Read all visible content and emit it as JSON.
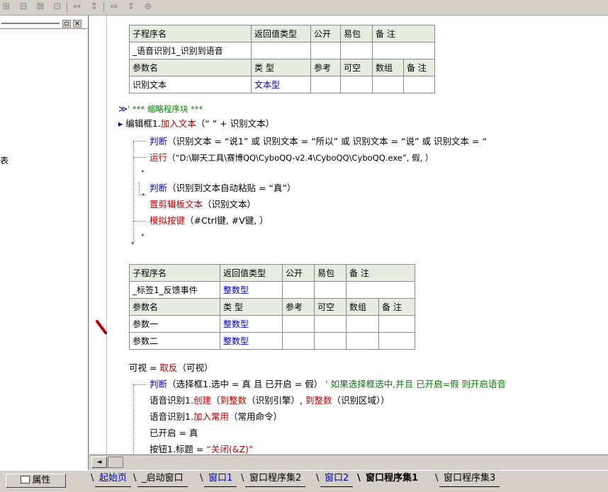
{
  "toolbar": {
    "icons": [
      "merge-cells-icon",
      "split-cells-icon",
      "insert-row-icon",
      "insert-col-icon",
      "width-icon",
      "height-icon",
      "fit-width-icon",
      "fit-height-icon",
      "fit-all-icon"
    ]
  },
  "left_panel": {
    "min_glyph": "▫",
    "close_glyph": "×",
    "fragment": "表"
  },
  "sub1": {
    "header": [
      "子程序名",
      "返回值类型",
      "公开",
      "易包",
      "备 注"
    ],
    "name": "_语音识别1_识别到语音",
    "param_header": [
      "参数名",
      "类 型",
      "参考",
      "可空",
      "数组",
      "备 注"
    ],
    "param_name": "识别文本",
    "param_type": "文本型"
  },
  "code1": {
    "fold_marker": "≫",
    "fold_comment": "' *** 缩略程序块 ***",
    "call_marker": "▸",
    "line1_obj": "编辑框1.",
    "line1_method": "加入文本",
    "line1_args": "（“ ” + 识别文本）",
    "line2_kw": "判断",
    "line2_rest": "（识别文本 = “说1” 或 识别文本 = “所以” 或 识别文本 = “说” 或 识别文本 = “",
    "line3_kw": "运行",
    "line3_args": "（“D:\\聊天工具\\赛博QQ\\CyboQQ-v2.4\\CyboQQ\\CyboQQ.exe”, 假, ）",
    "line4_kw": "判断",
    "line4_rest": "（识别到文本自动粘贴 = “真”）",
    "line5_kw": "置剪辑板文本",
    "line5_args": "（识别文本）",
    "line6_kw": "模拟按键",
    "line6_args": "（#Ctrl键, #V键, ）"
  },
  "sub2": {
    "header": [
      "子程序名",
      "返回值类型",
      "公开",
      "易包",
      "备 注"
    ],
    "name": "_标签1_反馈事件",
    "ret_type": "整数型",
    "param_header": [
      "参数名",
      "类 型",
      "参考",
      "可空",
      "数组",
      "备 注"
    ],
    "params": [
      {
        "name": "参数一",
        "type": "整数型"
      },
      {
        "name": "参数二",
        "type": "整数型"
      }
    ]
  },
  "code2": {
    "line1_a": "可视 = ",
    "line1_kw": "取反",
    "line1_args": "（可视）",
    "line2_kw": "判断",
    "line2_rest": "（选择框1.选中 = 真 且 已开启 = 假）",
    "line2_comment": "' 如果选择框选中,并且 已开启=假 则开启语音",
    "line3_obj": "语音识别1.",
    "line3_method": "创建",
    "line3_p": "（",
    "line3_kw": "到整数",
    "line3_mid": "（识别引擎）, ",
    "line3_kw2": "到整数",
    "line3_end": "（识别区域））",
    "line4_obj": "语音识别1.",
    "line4_method": "加入常用",
    "line4_args": "（常用命令）",
    "line5": "已开启 = 真",
    "line6_a": "按钮1.标题 = ",
    "line6_b": "“关闭(&Z)”"
  },
  "hscroll": {
    "left_glyph": "◄"
  },
  "bottom": {
    "properties_label": "属性",
    "tabs": [
      "起始页",
      "_启动窗口",
      "窗口1",
      "窗口程序集2",
      "窗口2",
      "窗口程序集1",
      "窗口程序集3"
    ],
    "active_tab": "窗口程序集1"
  },
  "colors": {
    "keyword": "#c00000",
    "type": "#0000c0",
    "comment": "#008000",
    "header_bg": "#e8ece0"
  }
}
